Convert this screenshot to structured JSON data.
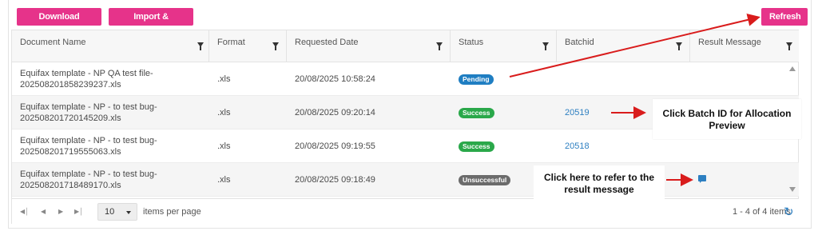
{
  "toolbar": {
    "download_label": "Download Template",
    "import_label": "Import & Generate",
    "refresh_label": "Refresh"
  },
  "columns": [
    "Document Name",
    "Format",
    "Requested Date",
    "Status",
    "Batchid",
    "Result Message"
  ],
  "rows": [
    {
      "doc_line1": "Equifax template - NP QA test file-",
      "doc_line2": "202508201858239237.xls",
      "format": ".xls",
      "date": "20/08/2025 10:58:24",
      "status": "Pending",
      "status_color": "#1f7ec2",
      "batchid": "",
      "result": ""
    },
    {
      "doc_line1": "Equifax template - NP - to test bug-",
      "doc_line2": "202508201720145209.xls",
      "format": ".xls",
      "date": "20/08/2025 09:20:14",
      "status": "Success",
      "status_color": "#2aa84a",
      "batchid": "20519",
      "result": ""
    },
    {
      "doc_line1": "Equifax template - NP - to test bug-",
      "doc_line2": "202508201719555063.xls",
      "format": ".xls",
      "date": "20/08/2025 09:19:55",
      "status": "Success",
      "status_color": "#2aa84a",
      "batchid": "20518",
      "result": ""
    },
    {
      "doc_line1": "Equifax template - NP - to test bug-",
      "doc_line2": "202508201718489170.xls",
      "format": ".xls",
      "date": "20/08/2025 09:18:49",
      "status": "Unsuccessful",
      "status_color": "#6b6b6b",
      "batchid": "",
      "result": "comment-icon"
    }
  ],
  "pager": {
    "page_size": "10",
    "items_label": "items per page",
    "range_label": "1 - 4 of 4 items"
  },
  "annotations": {
    "batch_line1": "Click Batch ID for Allocation",
    "batch_line2": "Preview",
    "result_line1": "Click here to refer to the",
    "result_line2": "result message",
    "arrow_color": "#d91c1c"
  },
  "colors": {
    "accent": "#e6338a",
    "link": "#2d7fc1"
  }
}
